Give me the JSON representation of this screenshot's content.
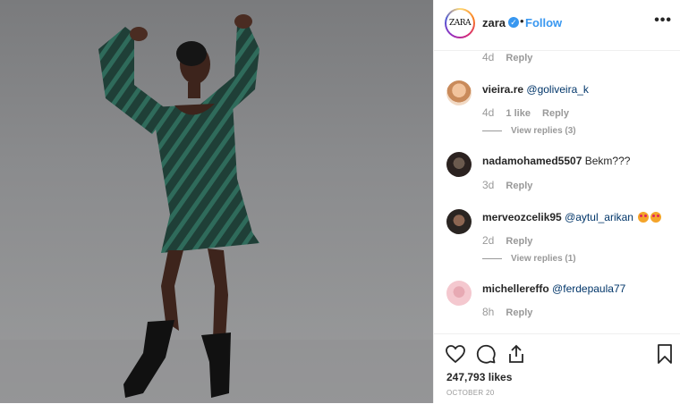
{
  "header": {
    "logo_text": "ZARA",
    "username": "zara",
    "verified_symbol": "✓",
    "separator": "•",
    "follow_label": "Follow",
    "more_label": "•••"
  },
  "comments": [
    {
      "username": "",
      "text": "",
      "time": "4d",
      "likes": "",
      "reply_label": "Reply",
      "view_replies": ""
    },
    {
      "username": "vieira.re",
      "mention": "@goliveira_k",
      "text": "",
      "time": "4d",
      "likes": "1 like",
      "reply_label": "Reply",
      "view_replies": "View replies (3)"
    },
    {
      "username": "nadamohamed5507",
      "mention": "",
      "text": "Bekm???",
      "time": "3d",
      "likes": "",
      "reply_label": "Reply",
      "view_replies": ""
    },
    {
      "username": "merveozcelik95",
      "mention": "@aytul_arikan",
      "text": "",
      "time": "2d",
      "likes": "",
      "reply_label": "Reply",
      "view_replies": "View replies (1)"
    },
    {
      "username": "michellereffo",
      "mention": "@ferdepaula77",
      "text": "",
      "time": "8h",
      "likes": "",
      "reply_label": "Reply",
      "view_replies": ""
    }
  ],
  "actions": {
    "icons": [
      "heart-icon",
      "comment-icon",
      "share-icon",
      "bookmark-icon"
    ]
  },
  "likes_count": "247,793 likes",
  "post_date": "OCTOBER 20",
  "colors": {
    "accent": "#3897f0",
    "mention": "#003569",
    "muted": "#999999"
  }
}
